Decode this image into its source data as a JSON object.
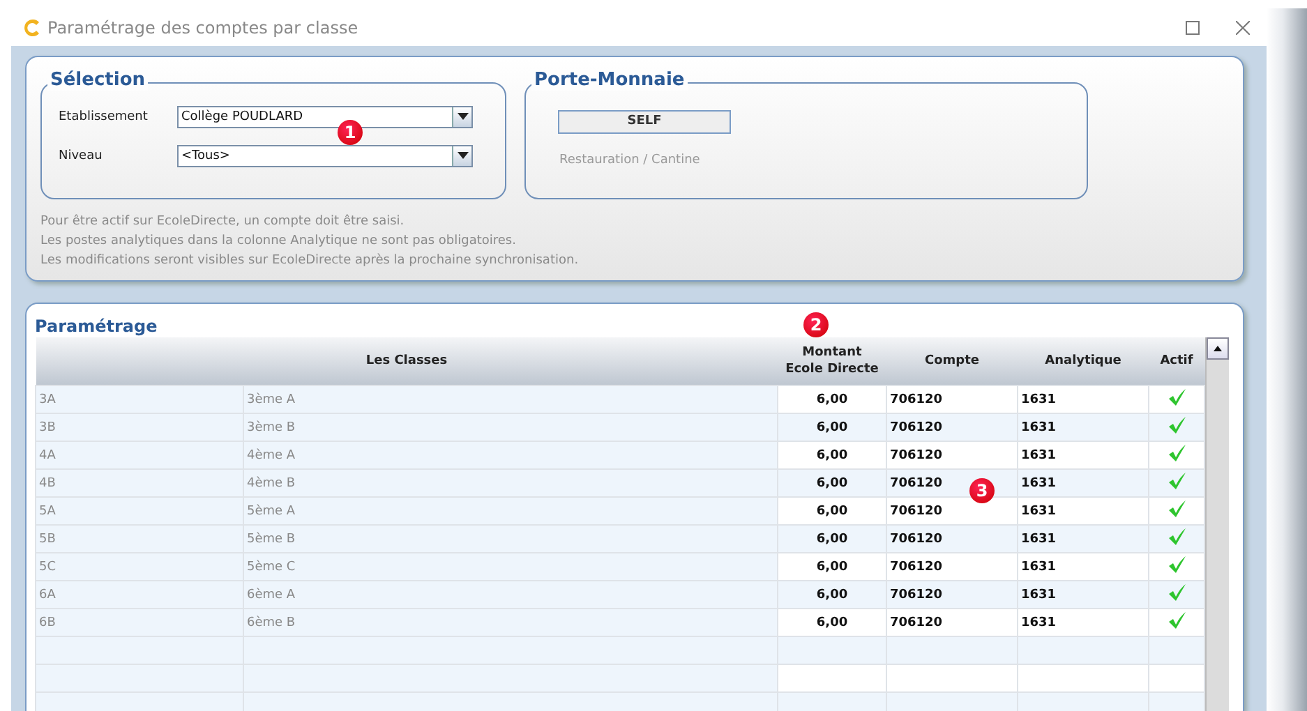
{
  "window": {
    "title": "Paramétrage des comptes par classe"
  },
  "selection": {
    "title": "Sélection",
    "fields": [
      {
        "label": "Etablissement",
        "value": "Collège POUDLARD"
      },
      {
        "label": "Niveau",
        "value": "<Tous>"
      }
    ]
  },
  "wallet": {
    "title": "Porte-Monnaie",
    "button": "SELF",
    "caption": "Restauration / Cantine"
  },
  "notes": [
    "Pour être actif sur EcoleDirecte, un compte doit être saisi.",
    "Les postes analytiques dans la colonne Analytique ne sont pas obligatoires.",
    "Les modifications seront visibles sur EcoleDirecte après la prochaine synchronisation."
  ],
  "table": {
    "title": "Paramétrage",
    "columns": [
      "Les Classes",
      "Montant\nEcole Directe",
      "Compte",
      "Analytique",
      "Actif"
    ],
    "rows": [
      {
        "code": "3A",
        "name": "3ème A",
        "amount": "6,00",
        "account": "706120",
        "analytic": "1631",
        "active": true
      },
      {
        "code": "3B",
        "name": "3ème B",
        "amount": "6,00",
        "account": "706120",
        "analytic": "1631",
        "active": true
      },
      {
        "code": "4A",
        "name": "4ème A",
        "amount": "6,00",
        "account": "706120",
        "analytic": "1631",
        "active": true
      },
      {
        "code": "4B",
        "name": "4ème B",
        "amount": "6,00",
        "account": "706120",
        "analytic": "1631",
        "active": true
      },
      {
        "code": "5A",
        "name": "5ème A",
        "amount": "6,00",
        "account": "706120",
        "analytic": "1631",
        "active": true
      },
      {
        "code": "5B",
        "name": "5ème B",
        "amount": "6,00",
        "account": "706120",
        "analytic": "1631",
        "active": true
      },
      {
        "code": "5C",
        "name": "5ème C",
        "amount": "6,00",
        "account": "706120",
        "analytic": "1631",
        "active": true
      },
      {
        "code": "6A",
        "name": "6ème A",
        "amount": "6,00",
        "account": "706120",
        "analytic": "1631",
        "active": true
      },
      {
        "code": "6B",
        "name": "6ème B",
        "amount": "6,00",
        "account": "706120",
        "analytic": "1631",
        "active": true
      }
    ]
  },
  "markers": [
    "1",
    "2",
    "3"
  ]
}
